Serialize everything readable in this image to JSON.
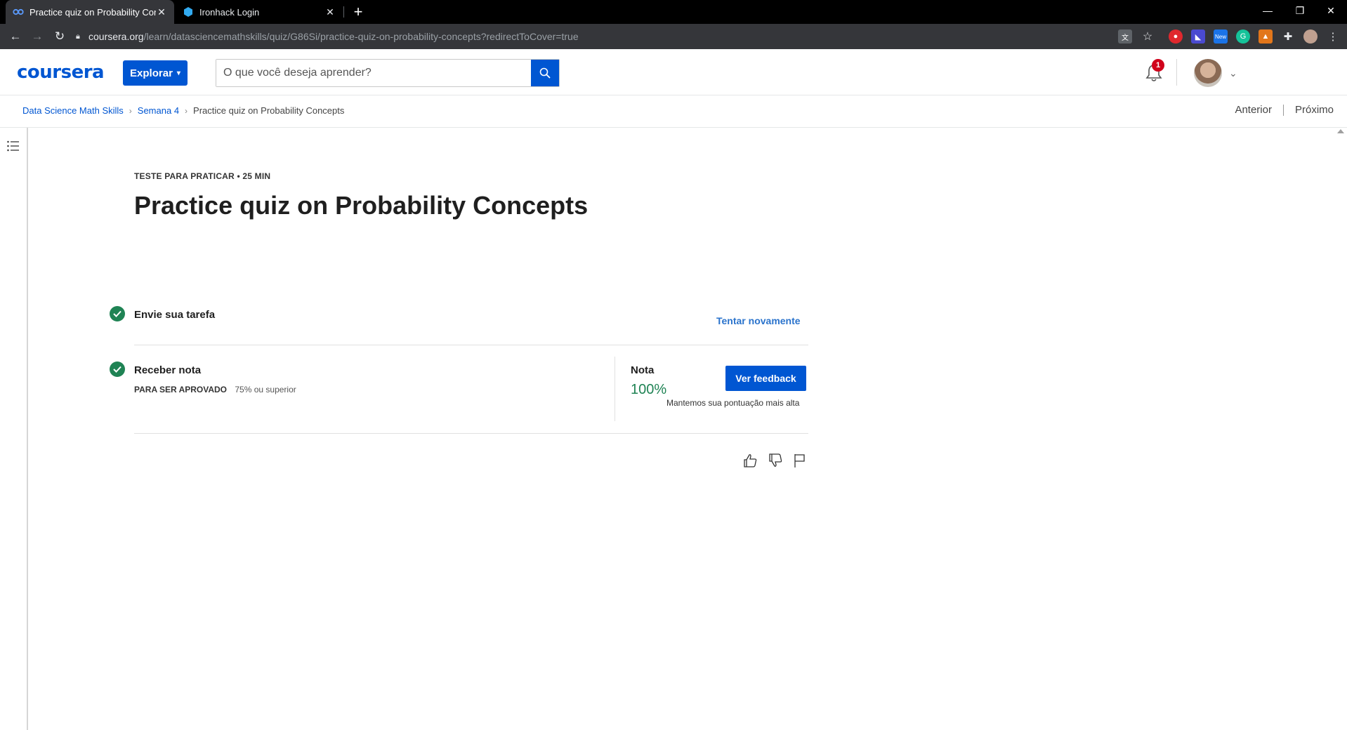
{
  "browser": {
    "tabs": [
      {
        "title": "Practice quiz on Probability Conc",
        "active": true
      },
      {
        "title": "Ironhack Login",
        "active": false
      }
    ],
    "url_host": "coursera.org",
    "url_path": "/learn/datasciencemathskills/quiz/G86Si/practice-quiz-on-probability-concepts?redirectToCover=true",
    "extension_badge": "New"
  },
  "header": {
    "logo": "coursera",
    "explore_label": "Explorar",
    "search_placeholder": "O que você deseja aprender?",
    "notification_count": "1"
  },
  "breadcrumb": {
    "items": [
      "Data Science Math Skills",
      "Semana 4",
      "Practice quiz on Probability Concepts"
    ]
  },
  "nav": {
    "previous": "Anterior",
    "next": "Próximo"
  },
  "quiz": {
    "kicker": "TESTE PARA PRATICAR • 25 MIN",
    "title": "Practice quiz on Probability Concepts",
    "step1": {
      "label": "Envie sua tarefa",
      "action": "Tentar novamente"
    },
    "step2": {
      "label": "Receber nota",
      "pass_label": "PARA SER APROVADO",
      "pass_value": "75% ou superior",
      "grade_label": "Nota",
      "grade_value": "100%",
      "feedback_button": "Ver feedback",
      "note": "Mantemos sua pontuação mais alta"
    }
  },
  "colors": {
    "brand_blue": "#0056d2",
    "success_green": "#1f8354",
    "link_blue": "#2a73cc"
  }
}
